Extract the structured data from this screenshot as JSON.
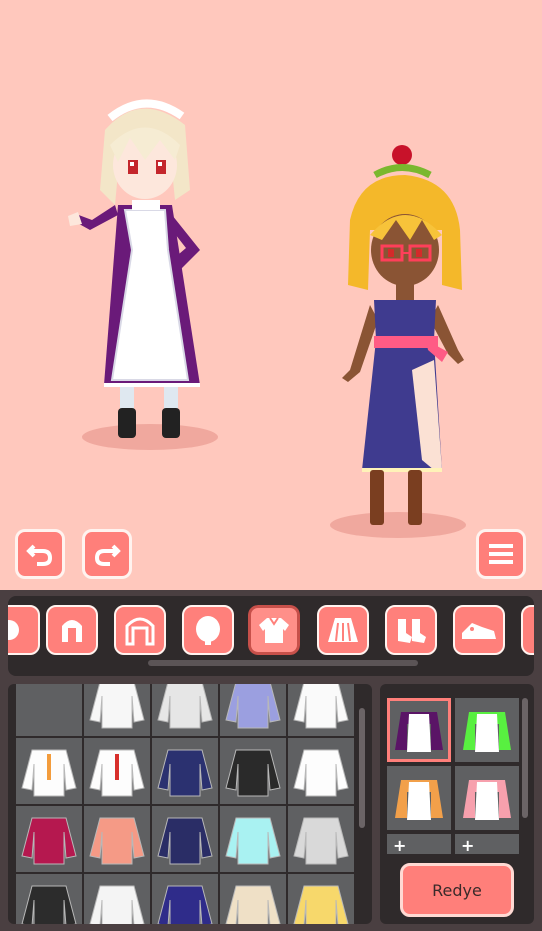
{
  "toolbar": {
    "undo_icon": "undo-icon",
    "redo_icon": "redo-icon",
    "menu_icon": "hamburger-menu-icon"
  },
  "category_tabs": [
    {
      "name": "partial-tab",
      "icon": "partial-icon"
    },
    {
      "name": "hair",
      "icon": "hair-icon"
    },
    {
      "name": "back-hair",
      "icon": "back-hair-icon"
    },
    {
      "name": "face",
      "icon": "face-icon"
    },
    {
      "name": "tops",
      "icon": "shirt-icon",
      "selected": true
    },
    {
      "name": "skirt",
      "icon": "skirt-icon"
    },
    {
      "name": "socks",
      "icon": "socks-icon"
    },
    {
      "name": "shoes",
      "icon": "shoes-icon"
    },
    {
      "name": "more",
      "icon": "more-icon"
    }
  ],
  "items": [
    "empty",
    "white-top",
    "gray-top",
    "lavender-top",
    "white-blouse",
    "orange-tie-shirt",
    "red-tie-shirt",
    "navy-blazer",
    "black-cardigan",
    "white-bow-blouse",
    "magenta-off-shoulder",
    "pink-sweater",
    "navy-sailor-top",
    "aqua-cami",
    "gray-crop-top",
    "black-jacket",
    "white-tank",
    "navy-tube-top",
    "beige-cardigan",
    "yellow-top"
  ],
  "color_variants": [
    {
      "name": "purple-white",
      "selected": true
    },
    {
      "name": "green-white"
    },
    {
      "name": "orange-white"
    },
    {
      "name": "pink-white"
    }
  ],
  "plus_labels": [
    "+",
    "+"
  ],
  "redye_label": "Redye",
  "colors": {
    "background": "#ffc8bd",
    "accent": "#ff7f7a",
    "panel": "#4a3f41"
  }
}
